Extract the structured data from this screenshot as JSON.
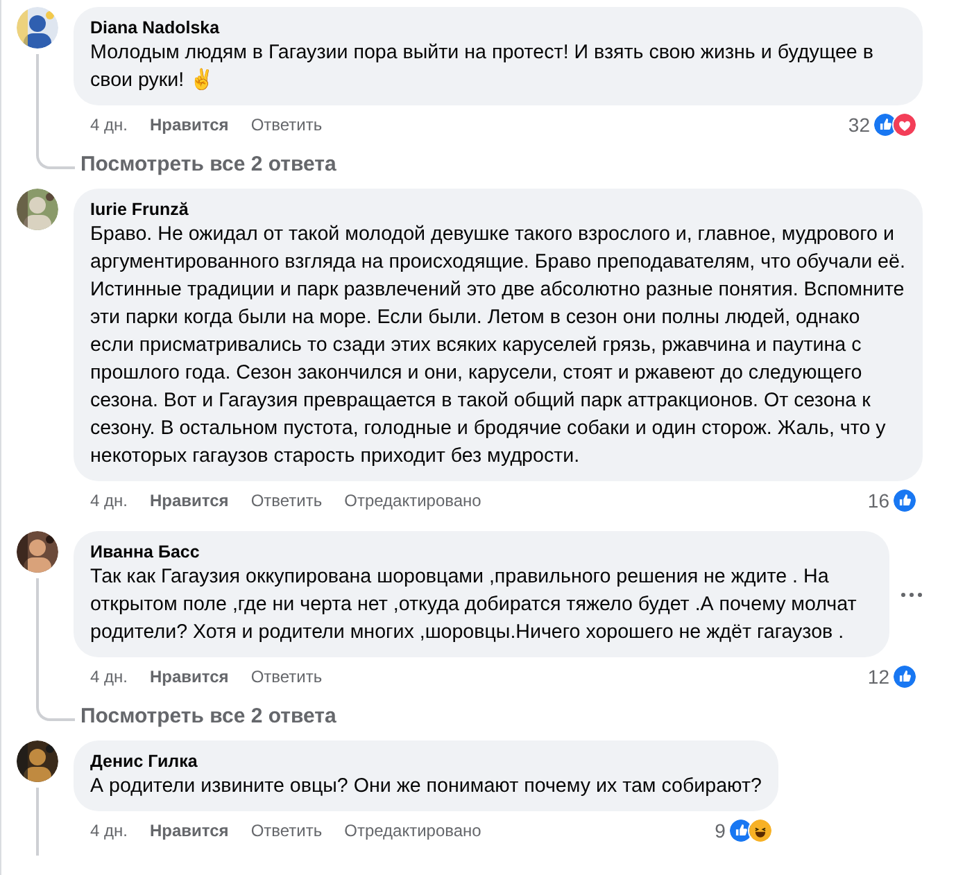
{
  "comments": [
    {
      "author": "Diana Nadolska",
      "text": "Молодым людям в Гагаузии пора выйти на протест! И взять свою жизнь и будущее в свои руки! ✌",
      "time": "4 дн.",
      "like": "Нравится",
      "reply": "Ответить",
      "reaction_count": "32",
      "reactions": [
        {
          "kind": "like"
        },
        {
          "kind": "love"
        }
      ],
      "thread_line": true,
      "replies_link": "Посмотреть все 2 ответа",
      "menu": false
    },
    {
      "author": "Iurie Frunză",
      "text": "Браво. Не ожидал от такой молодой девушке такого взрослого и, главное, мудрового и аргументированного взгляда на происходящие. Браво преподавателям, что обучали её. Истинные традиции и парк развлечений это две абсолютно разные понятия. Вспомните эти парки когда были на море. Если были. Летом в сезон они полны людей, однако если присматривались то сзади этих всяких каруселей грязь, ржавчина и паутина с прошлого года. Сезон закончился и они, карусели, стоят и ржавеют до следующего сезона. Вот и Гагаузия превращается в такой общий парк аттракционов. От сезона к сезону. В остальном пустота, голодные и бродячие собаки и один сторож. Жаль, что у некоторых гагаузов старость приходит без мудрости.",
      "time": "4 дн.",
      "like": "Нравится",
      "reply": "Ответить",
      "edited": "Отредактировано",
      "reaction_count": "16",
      "reactions": [
        {
          "kind": "like"
        }
      ],
      "thread_line": false,
      "menu": false
    },
    {
      "author": "Иванна Басс",
      "text": "Так как Гагаузия оккупирована шоровцами ,правильного решения не ждите . На открытом поле ,где ни черта нет ,откуда добиратся тяжело будет .А почему молчат родители? Хотя и родители многих ,шоровцы.Ничего хорошего не ждёт гагаузов .",
      "time": "4 дн.",
      "like": "Нравится",
      "reply": "Ответить",
      "reaction_count": "12",
      "reactions": [
        {
          "kind": "like"
        }
      ],
      "thread_line": true,
      "replies_link": "Посмотреть все 2 ответа",
      "menu": true
    },
    {
      "author": "Денис Гилка",
      "text": "А родители извините овцы? Они же понимают почему их там собирают?",
      "time": "4 дн.",
      "like": "Нравится",
      "reply": "Ответить",
      "edited": "Отредактировано",
      "reaction_count": "9",
      "reactions": [
        {
          "kind": "like"
        },
        {
          "kind": "haha"
        }
      ],
      "thread_line": true,
      "menu": false
    }
  ]
}
